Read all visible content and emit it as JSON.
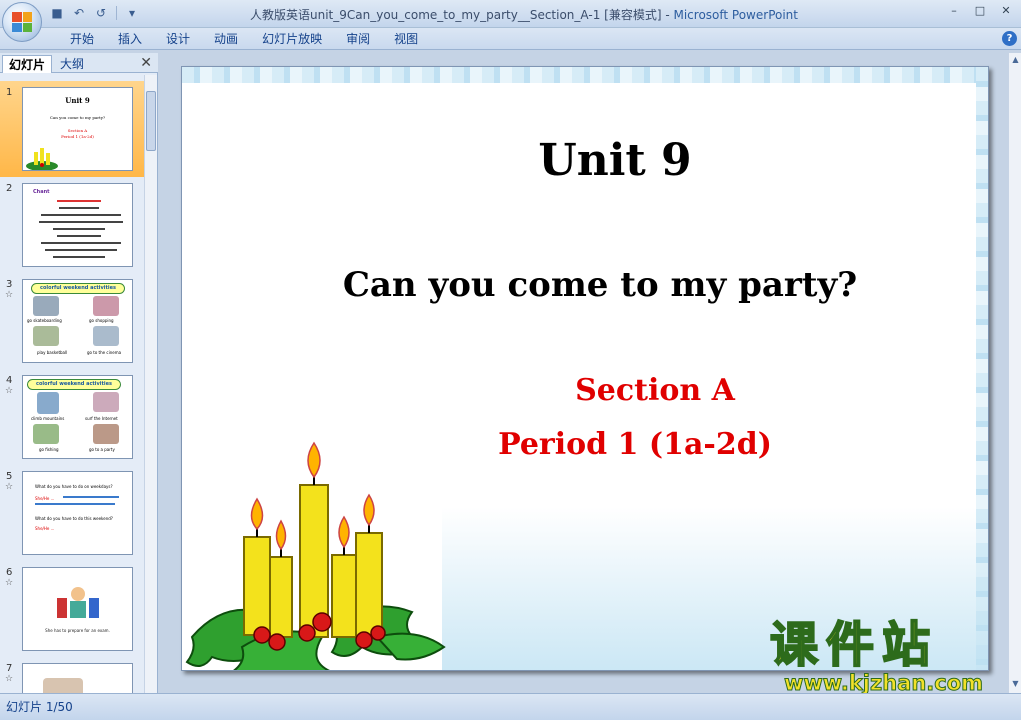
{
  "window": {
    "title_doc": "人教版英语unit_9Can_you_come_to_my_party__Section_A-1 [兼容模式]",
    "title_sep": " - ",
    "title_app": "Microsoft PowerPoint"
  },
  "ribbon": {
    "tabs": [
      "开始",
      "插入",
      "设计",
      "动画",
      "幻灯片放映",
      "审阅",
      "视图"
    ]
  },
  "panel": {
    "tab_slides": "幻灯片",
    "tab_outline": "大纲"
  },
  "thumbnails": [
    {
      "num": "1",
      "line1": "Unit 9",
      "line2": "Can you come to my party?",
      "line3": "Section A",
      "line4": "Period 1 (1a-2d)"
    },
    {
      "num": "2",
      "line1": "Chant"
    },
    {
      "num": "3",
      "line1": "colorful weekend activities",
      "a": "go skateboarding",
      "b": "go shopping",
      "c": "play basketball",
      "d": "go to the cinema"
    },
    {
      "num": "4",
      "line1": "colorful weekend activities",
      "a": "climb mountains",
      "b": "surf the Internet",
      "c": "go fishing",
      "d": "go to a party"
    },
    {
      "num": "5",
      "line1": "What do you have to do on weekdays?",
      "line2": "She/He ...",
      "line3": "What do you have to do this weekend?",
      "line4": "She/He ..."
    },
    {
      "num": "6",
      "line1": "She has to prepare for an exam."
    },
    {
      "num": "7"
    }
  ],
  "slide": {
    "title": "Unit 9",
    "subtitle": "Can you come to my party?",
    "section": "Section A",
    "period": "Period 1 (1a-2d)"
  },
  "status": {
    "slide_counter": "幻灯片 1/50"
  },
  "watermark": {
    "chinese": "课件站",
    "url": "www.kjzhan.com"
  }
}
